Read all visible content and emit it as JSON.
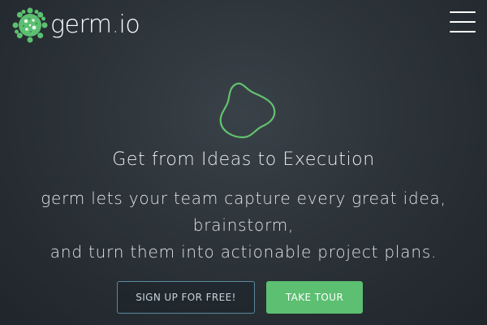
{
  "header": {
    "logo": {
      "icon": "germ-icon",
      "name": "germ",
      "dot": ".",
      "tld": "io"
    },
    "menu_icon": "hamburger-menu-icon"
  },
  "hero": {
    "illustration_icon": "blob-outline-icon",
    "title": "Get from Ideas to Execution",
    "text_lines": [
      "germ lets your team capture every great idea,",
      "brainstorm,",
      "and turn them into actionable project plans."
    ]
  },
  "actions": {
    "signup_label": "SIGN UP FOR FREE!",
    "tour_label": "TAKE TOUR"
  },
  "colors": {
    "brand_green": "#5cbf71",
    "background": "#2c3339",
    "outline_button_border": "#5b8aa0"
  }
}
